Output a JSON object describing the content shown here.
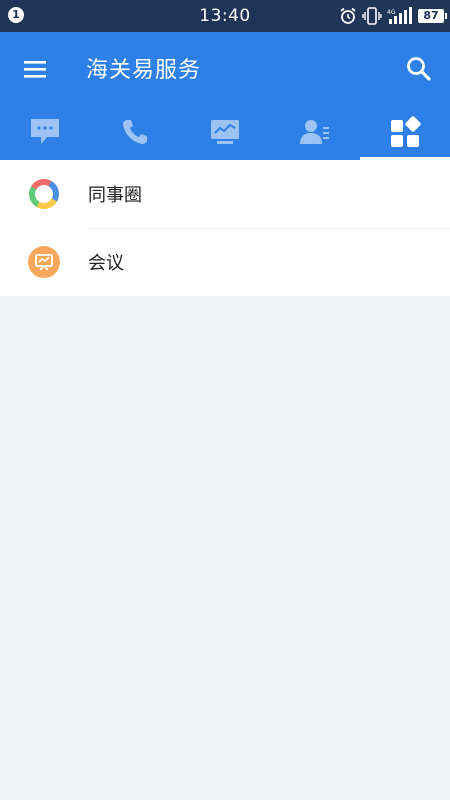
{
  "status_bar": {
    "notification_count": "1",
    "time": "13:40",
    "network_type": "4G",
    "battery_level": "87"
  },
  "app_bar": {
    "title": "海关易服务"
  },
  "tabs": [
    {
      "icon": "message-icon",
      "active": false
    },
    {
      "icon": "phone-icon",
      "active": false
    },
    {
      "icon": "monitor-chart-icon",
      "active": false
    },
    {
      "icon": "contacts-icon",
      "active": false
    },
    {
      "icon": "apps-icon",
      "active": true
    }
  ],
  "list": {
    "items": [
      {
        "label": "同事圈",
        "icon": "colleague-circle-icon"
      },
      {
        "label": "会议",
        "icon": "meeting-icon"
      }
    ]
  },
  "colors": {
    "app_bar": "#2e80e6",
    "status_bar": "#1f3457",
    "background": "#f1f2f4",
    "meeting_icon": "#f6a75a"
  }
}
